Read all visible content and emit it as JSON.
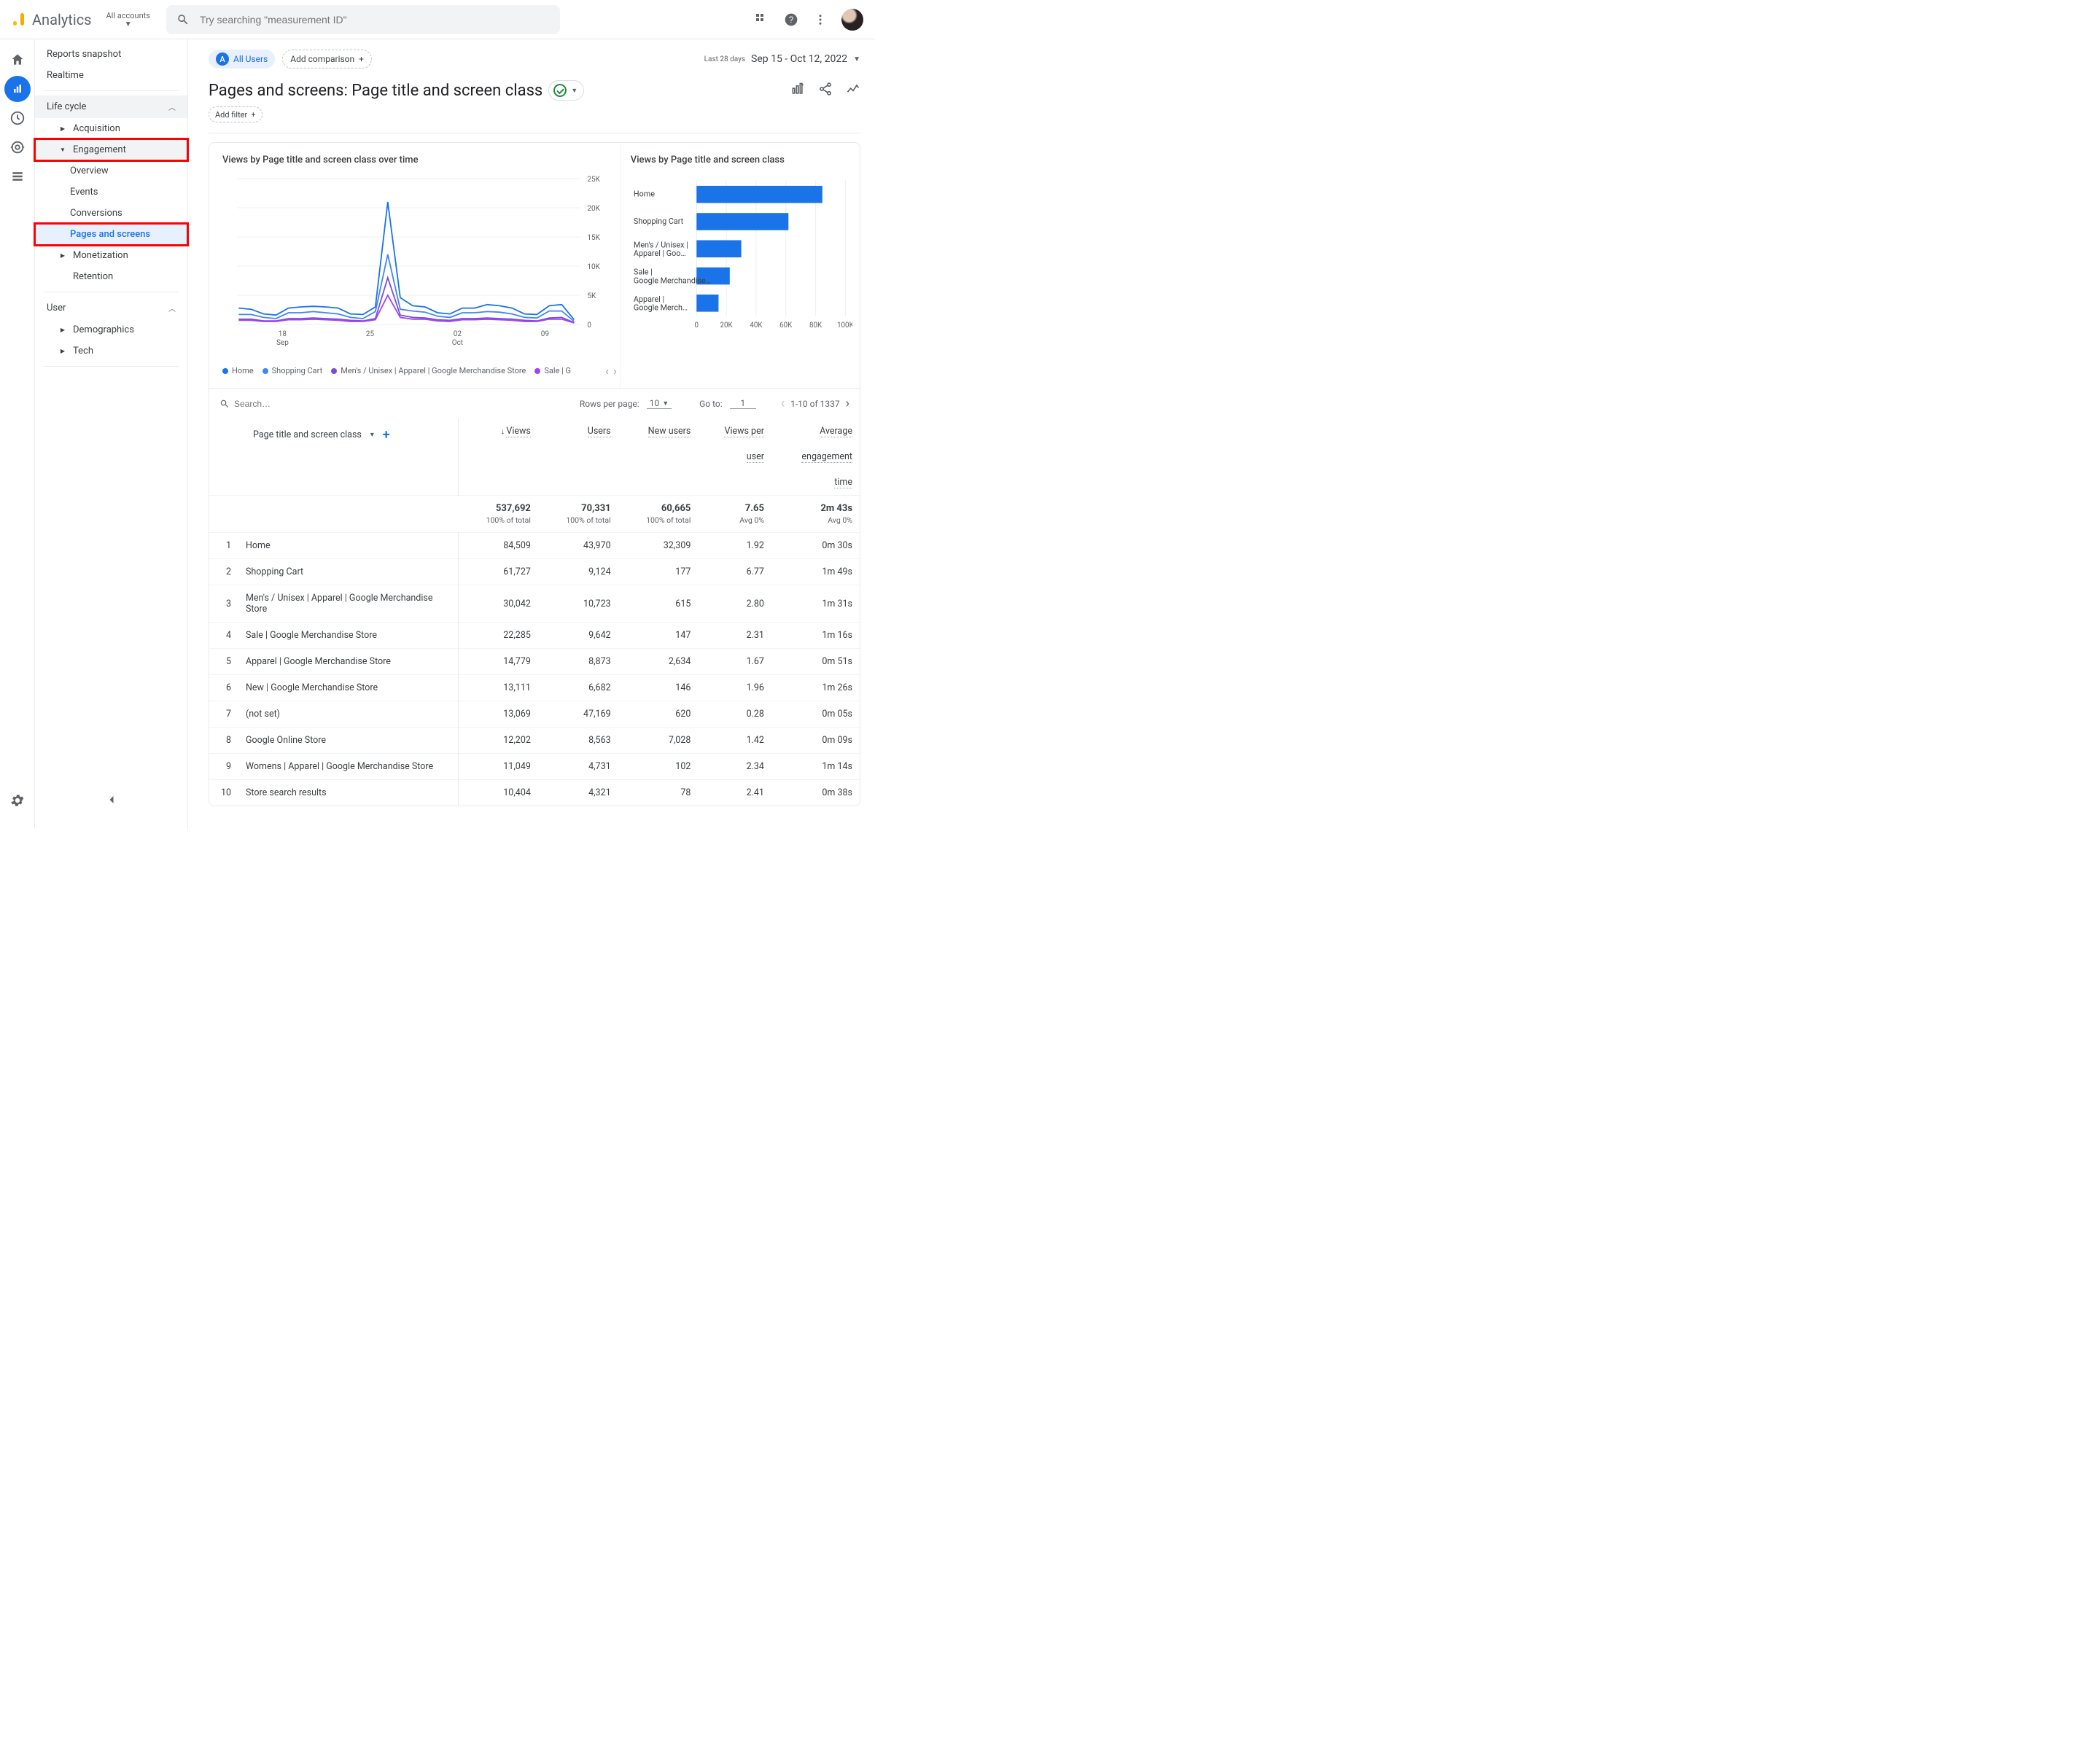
{
  "header": {
    "brand": "Analytics",
    "account_label": "All accounts",
    "search_placeholder": "Try searching \"measurement ID\""
  },
  "left_rail": {
    "home": "home",
    "reports": "reports",
    "explore": "explore",
    "advertising": "advertising",
    "configure": "configure",
    "admin": "admin"
  },
  "sidenav": {
    "reports_snapshot": "Reports snapshot",
    "realtime": "Realtime",
    "life_cycle": "Life cycle",
    "acquisition": "Acquisition",
    "engagement": "Engagement",
    "overview": "Overview",
    "events": "Events",
    "conversions": "Conversions",
    "pages_and_screens": "Pages and screens",
    "monetization": "Monetization",
    "retention": "Retention",
    "user": "User",
    "demographics": "Demographics",
    "tech": "Tech"
  },
  "top": {
    "all_users_badge": "A",
    "all_users": "All Users",
    "add_comparison": "Add comparison",
    "last_n": "Last 28 days",
    "date_range": "Sep 15 - Oct 12, 2022",
    "page_title": "Pages and screens: Page title and screen class",
    "add_filter": "Add filter"
  },
  "charts": {
    "line_title": "Views by Page title and screen class over time",
    "bar_title": "Views by Page title and screen class",
    "legend": [
      "Home",
      "Shopping Cart",
      "Men's / Unisex | Apparel | Google Merchandise Store",
      "Sale | G"
    ],
    "colors": [
      "#1a73e8",
      "#4285f4",
      "#7b4dd6",
      "#a142f4"
    ],
    "y_ticks": [
      "25K",
      "20K",
      "15K",
      "10K",
      "5K",
      "0"
    ],
    "x_ticks": [
      {
        "top": "18",
        "bot": "Sep"
      },
      {
        "top": "25",
        "bot": ""
      },
      {
        "top": "02",
        "bot": "Oct"
      },
      {
        "top": "09",
        "bot": ""
      }
    ],
    "bar_labels": [
      "Home",
      "Shopping Cart",
      "Men's / Unisex | Apparel | Goo…",
      "Sale | Google Merchandise…",
      "Apparel | Google Merch…"
    ],
    "bar_x_ticks": [
      "0",
      "20K",
      "40K",
      "60K",
      "80K",
      "100K"
    ]
  },
  "chart_data": {
    "line": {
      "type": "line",
      "title": "Views by Page title and screen class over time",
      "x_dates": [
        "Sep 15",
        "Sep 16",
        "Sep 17",
        "Sep 18",
        "Sep 19",
        "Sep 20",
        "Sep 21",
        "Sep 22",
        "Sep 23",
        "Sep 24",
        "Sep 25",
        "Sep 26",
        "Sep 27",
        "Sep 28",
        "Sep 29",
        "Sep 30",
        "Oct 01",
        "Oct 02",
        "Oct 03",
        "Oct 04",
        "Oct 05",
        "Oct 06",
        "Oct 07",
        "Oct 08",
        "Oct 09",
        "Oct 10",
        "Oct 11",
        "Oct 12"
      ],
      "ylim": [
        0,
        25000
      ],
      "series": [
        {
          "name": "Home",
          "color": "#1a73e8",
          "values": [
            2800,
            2600,
            1800,
            1600,
            2800,
            3000,
            3100,
            3000,
            2800,
            1800,
            1700,
            3000,
            21000,
            4600,
            3200,
            3000,
            2000,
            1800,
            2800,
            2800,
            3400,
            3200,
            2800,
            1800,
            1700,
            3200,
            3400,
            800
          ]
        },
        {
          "name": "Shopping Cart",
          "color": "#4285f4",
          "values": [
            1700,
            1700,
            1200,
            1000,
            2000,
            2000,
            2200,
            2000,
            1800,
            1200,
            1000,
            2200,
            12000,
            2600,
            2300,
            2100,
            1400,
            1200,
            2000,
            2000,
            2200,
            2100,
            1800,
            1200,
            1100,
            2300,
            2300,
            500
          ]
        },
        {
          "name": "Men's / Unisex | Apparel | Google Merchandise Store",
          "color": "#7b4dd6",
          "values": [
            900,
            900,
            600,
            600,
            1000,
            1000,
            1100,
            1000,
            900,
            700,
            600,
            1000,
            8000,
            1600,
            1200,
            1100,
            800,
            700,
            1000,
            1000,
            1100,
            1000,
            900,
            700,
            600,
            1100,
            1200,
            300
          ]
        },
        {
          "name": "Sale | Google Merchandise Store",
          "color": "#a142f4",
          "values": [
            700,
            700,
            500,
            500,
            800,
            800,
            900,
            800,
            700,
            500,
            500,
            800,
            5000,
            1200,
            900,
            900,
            600,
            500,
            800,
            800,
            900,
            800,
            700,
            500,
            500,
            900,
            900,
            250
          ]
        }
      ]
    },
    "bar": {
      "type": "bar",
      "title": "Views by Page title and screen class",
      "xlim": [
        0,
        100000
      ],
      "categories": [
        "Home",
        "Shopping Cart",
        "Men's / Unisex | Apparel | Google Merchandise Store",
        "Sale | Google Merchandise Store",
        "Apparel | Google Merchandise Store"
      ],
      "values": [
        84509,
        61727,
        30042,
        22285,
        14779
      ]
    }
  },
  "table_controls": {
    "search_placeholder": "Search…",
    "rows_per_page": "Rows per page:",
    "rpp_value": "10",
    "go_to": "Go to:",
    "go_to_value": "1",
    "range": "1-10 of 1337"
  },
  "table_headers": {
    "dim": "Page title and screen class",
    "views": "Views",
    "users": "Users",
    "new_users": "New users",
    "views_per_user_l1": "Views per",
    "views_per_user_l2": "user",
    "aet_l1": "Average",
    "aet_l2": "engagement",
    "aet_l3": "time"
  },
  "totals": {
    "views": "537,692",
    "views_sub": "100% of total",
    "users": "70,331",
    "users_sub": "100% of total",
    "new_users": "60,665",
    "new_users_sub": "100% of total",
    "vpu": "7.65",
    "vpu_sub": "Avg 0%",
    "aet": "2m 43s",
    "aet_sub": "Avg 0%"
  },
  "rows": [
    {
      "i": "1",
      "name": "Home",
      "views": "84,509",
      "users": "43,970",
      "new": "32,309",
      "vpu": "1.92",
      "aet": "0m 30s"
    },
    {
      "i": "2",
      "name": "Shopping Cart",
      "views": "61,727",
      "users": "9,124",
      "new": "177",
      "vpu": "6.77",
      "aet": "1m 49s"
    },
    {
      "i": "3",
      "name": "Men's / Unisex | Apparel | Google Merchandise Store",
      "views": "30,042",
      "users": "10,723",
      "new": "615",
      "vpu": "2.80",
      "aet": "1m 31s"
    },
    {
      "i": "4",
      "name": "Sale | Google Merchandise Store",
      "views": "22,285",
      "users": "9,642",
      "new": "147",
      "vpu": "2.31",
      "aet": "1m 16s"
    },
    {
      "i": "5",
      "name": "Apparel | Google Merchandise Store",
      "views": "14,779",
      "users": "8,873",
      "new": "2,634",
      "vpu": "1.67",
      "aet": "0m 51s"
    },
    {
      "i": "6",
      "name": "New | Google Merchandise Store",
      "views": "13,111",
      "users": "6,682",
      "new": "146",
      "vpu": "1.96",
      "aet": "1m 26s"
    },
    {
      "i": "7",
      "name": "(not set)",
      "views": "13,069",
      "users": "47,169",
      "new": "620",
      "vpu": "0.28",
      "aet": "0m 05s"
    },
    {
      "i": "8",
      "name": "Google Online Store",
      "views": "12,202",
      "users": "8,563",
      "new": "7,028",
      "vpu": "1.42",
      "aet": "0m 09s"
    },
    {
      "i": "9",
      "name": "Womens | Apparel | Google Merchandise Store",
      "views": "11,049",
      "users": "4,731",
      "new": "102",
      "vpu": "2.34",
      "aet": "1m 14s"
    },
    {
      "i": "10",
      "name": "Store search results",
      "views": "10,404",
      "users": "4,321",
      "new": "78",
      "vpu": "2.41",
      "aet": "0m 38s"
    }
  ]
}
